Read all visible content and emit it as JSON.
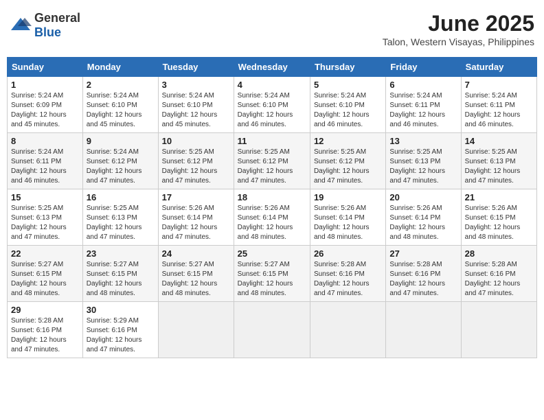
{
  "header": {
    "logo_general": "General",
    "logo_blue": "Blue",
    "month_title": "June 2025",
    "location": "Talon, Western Visayas, Philippines"
  },
  "days_of_week": [
    "Sunday",
    "Monday",
    "Tuesday",
    "Wednesday",
    "Thursday",
    "Friday",
    "Saturday"
  ],
  "weeks": [
    [
      {
        "day": "1",
        "sunrise": "5:24 AM",
        "sunset": "6:09 PM",
        "daylight": "12 hours and 45 minutes."
      },
      {
        "day": "2",
        "sunrise": "5:24 AM",
        "sunset": "6:10 PM",
        "daylight": "12 hours and 45 minutes."
      },
      {
        "day": "3",
        "sunrise": "5:24 AM",
        "sunset": "6:10 PM",
        "daylight": "12 hours and 45 minutes."
      },
      {
        "day": "4",
        "sunrise": "5:24 AM",
        "sunset": "6:10 PM",
        "daylight": "12 hours and 46 minutes."
      },
      {
        "day": "5",
        "sunrise": "5:24 AM",
        "sunset": "6:10 PM",
        "daylight": "12 hours and 46 minutes."
      },
      {
        "day": "6",
        "sunrise": "5:24 AM",
        "sunset": "6:11 PM",
        "daylight": "12 hours and 46 minutes."
      },
      {
        "day": "7",
        "sunrise": "5:24 AM",
        "sunset": "6:11 PM",
        "daylight": "12 hours and 46 minutes."
      }
    ],
    [
      {
        "day": "8",
        "sunrise": "5:24 AM",
        "sunset": "6:11 PM",
        "daylight": "12 hours and 46 minutes."
      },
      {
        "day": "9",
        "sunrise": "5:24 AM",
        "sunset": "6:12 PM",
        "daylight": "12 hours and 47 minutes."
      },
      {
        "day": "10",
        "sunrise": "5:25 AM",
        "sunset": "6:12 PM",
        "daylight": "12 hours and 47 minutes."
      },
      {
        "day": "11",
        "sunrise": "5:25 AM",
        "sunset": "6:12 PM",
        "daylight": "12 hours and 47 minutes."
      },
      {
        "day": "12",
        "sunrise": "5:25 AM",
        "sunset": "6:12 PM",
        "daylight": "12 hours and 47 minutes."
      },
      {
        "day": "13",
        "sunrise": "5:25 AM",
        "sunset": "6:13 PM",
        "daylight": "12 hours and 47 minutes."
      },
      {
        "day": "14",
        "sunrise": "5:25 AM",
        "sunset": "6:13 PM",
        "daylight": "12 hours and 47 minutes."
      }
    ],
    [
      {
        "day": "15",
        "sunrise": "5:25 AM",
        "sunset": "6:13 PM",
        "daylight": "12 hours and 47 minutes."
      },
      {
        "day": "16",
        "sunrise": "5:25 AM",
        "sunset": "6:13 PM",
        "daylight": "12 hours and 47 minutes."
      },
      {
        "day": "17",
        "sunrise": "5:26 AM",
        "sunset": "6:14 PM",
        "daylight": "12 hours and 47 minutes."
      },
      {
        "day": "18",
        "sunrise": "5:26 AM",
        "sunset": "6:14 PM",
        "daylight": "12 hours and 48 minutes."
      },
      {
        "day": "19",
        "sunrise": "5:26 AM",
        "sunset": "6:14 PM",
        "daylight": "12 hours and 48 minutes."
      },
      {
        "day": "20",
        "sunrise": "5:26 AM",
        "sunset": "6:14 PM",
        "daylight": "12 hours and 48 minutes."
      },
      {
        "day": "21",
        "sunrise": "5:26 AM",
        "sunset": "6:15 PM",
        "daylight": "12 hours and 48 minutes."
      }
    ],
    [
      {
        "day": "22",
        "sunrise": "5:27 AM",
        "sunset": "6:15 PM",
        "daylight": "12 hours and 48 minutes."
      },
      {
        "day": "23",
        "sunrise": "5:27 AM",
        "sunset": "6:15 PM",
        "daylight": "12 hours and 48 minutes."
      },
      {
        "day": "24",
        "sunrise": "5:27 AM",
        "sunset": "6:15 PM",
        "daylight": "12 hours and 48 minutes."
      },
      {
        "day": "25",
        "sunrise": "5:27 AM",
        "sunset": "6:15 PM",
        "daylight": "12 hours and 48 minutes."
      },
      {
        "day": "26",
        "sunrise": "5:28 AM",
        "sunset": "6:16 PM",
        "daylight": "12 hours and 47 minutes."
      },
      {
        "day": "27",
        "sunrise": "5:28 AM",
        "sunset": "6:16 PM",
        "daylight": "12 hours and 47 minutes."
      },
      {
        "day": "28",
        "sunrise": "5:28 AM",
        "sunset": "6:16 PM",
        "daylight": "12 hours and 47 minutes."
      }
    ],
    [
      {
        "day": "29",
        "sunrise": "5:28 AM",
        "sunset": "6:16 PM",
        "daylight": "12 hours and 47 minutes."
      },
      {
        "day": "30",
        "sunrise": "5:29 AM",
        "sunset": "6:16 PM",
        "daylight": "12 hours and 47 minutes."
      },
      null,
      null,
      null,
      null,
      null
    ]
  ],
  "labels": {
    "sunrise": "Sunrise:",
    "sunset": "Sunset:",
    "daylight": "Daylight:"
  }
}
